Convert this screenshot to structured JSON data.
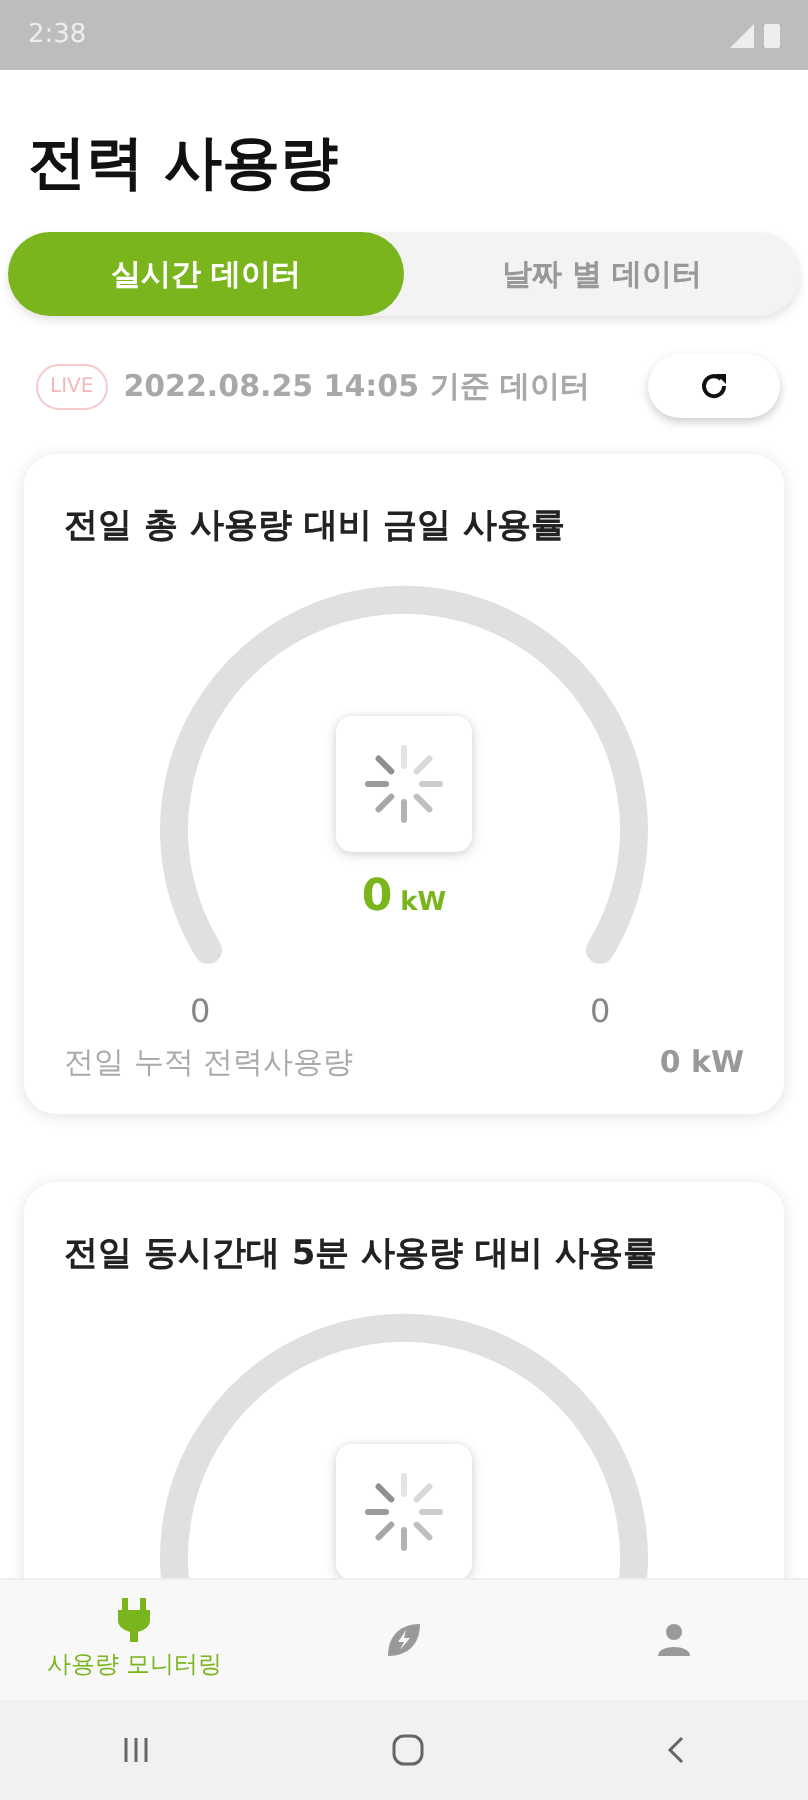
{
  "status_bar": {
    "time": "2:38"
  },
  "title": "전력 사용량",
  "tabs": [
    {
      "label": "실시간 데이터",
      "selected": true
    },
    {
      "label": "날짜 별 데이터",
      "selected": false
    }
  ],
  "live": {
    "badge": "LIVE",
    "timestamp": "2022.08.25 14:05 기준 데이터"
  },
  "cards": [
    {
      "title": "전일 총 사용량 대비 금일 사용률",
      "value": "0",
      "unit": "kW",
      "min_label": "0",
      "max_label": "0",
      "footer_label": "전일 누적 전력사용량",
      "footer_value": "0 kW",
      "loading": true
    },
    {
      "title": "전일 동시간대 5분 사용량 대비 사용률",
      "loading": true
    }
  ],
  "bottom_nav": [
    {
      "kind": "plug",
      "label": "사용량 모니터링",
      "selected": true
    },
    {
      "kind": "leaf",
      "selected": false
    },
    {
      "kind": "person",
      "selected": false
    }
  ]
}
